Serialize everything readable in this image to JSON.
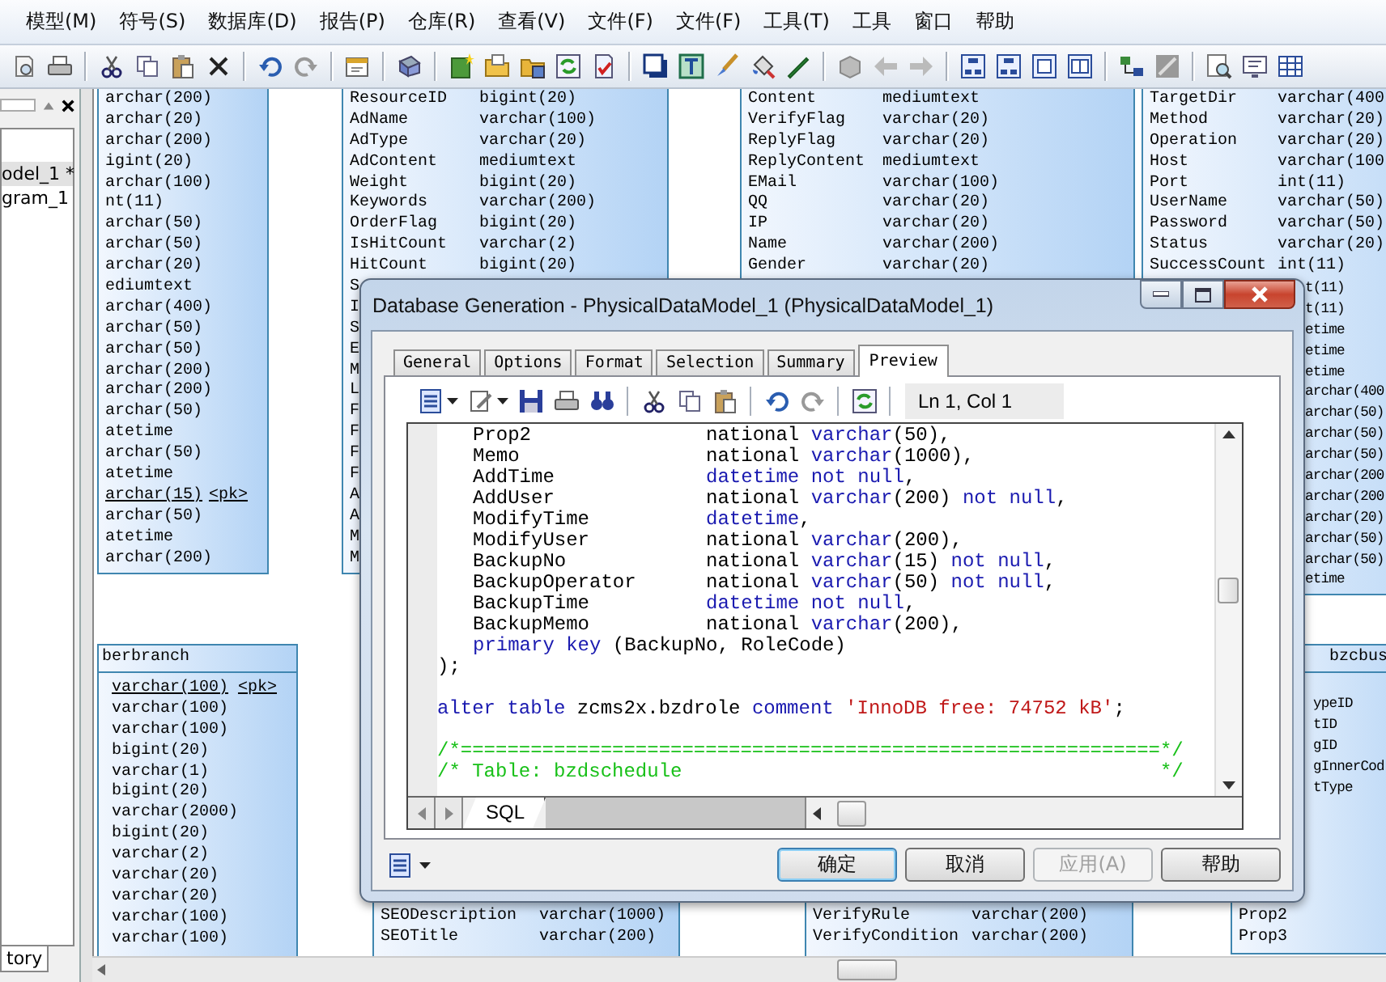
{
  "menu": [
    "模型(M)",
    "符号(S)",
    "数据库(D)",
    "报告(P)",
    "仓库(R)",
    "查看(V)",
    "文件(F)",
    "文件(F)",
    "工具(T)",
    "工具",
    "窗口",
    "帮助"
  ],
  "browser": {
    "items": [
      {
        "label": "odel_1 *",
        "selected": true
      },
      {
        "label": "gram_1",
        "selected": false
      }
    ],
    "tab": "tory"
  },
  "diagram": {
    "tables": [
      {
        "rows": [
          {
            "type": "archar(200)"
          },
          {
            "type": "archar(20)"
          },
          {
            "type": "archar(200)"
          },
          {
            "type": "igint(20)"
          },
          {
            "type": "archar(100)"
          },
          {
            "type": "nt(11)"
          },
          {
            "type": "archar(50)"
          },
          {
            "type": "archar(50)"
          },
          {
            "type": "archar(20)"
          },
          {
            "type": "ediumtext"
          },
          {
            "type": "archar(400)"
          },
          {
            "type": "archar(50)"
          },
          {
            "type": "archar(50)"
          },
          {
            "type": "archar(200)"
          },
          {
            "type": "archar(200)"
          },
          {
            "type": "archar(50)"
          },
          {
            "type": "atetime"
          },
          {
            "type": "archar(50)"
          },
          {
            "type": "atetime"
          },
          {
            "type": "archar(15)",
            "key": "<pk>"
          },
          {
            "type": "archar(50)"
          },
          {
            "type": "atetime"
          },
          {
            "type": "archar(200)"
          }
        ]
      },
      {
        "rows": [
          {
            "name": "ResourceID",
            "type": "bigint(20)"
          },
          {
            "name": "AdName",
            "type": "varchar(100)"
          },
          {
            "name": "AdType",
            "type": "varchar(20)"
          },
          {
            "name": "AdContent",
            "type": "mediumtext"
          },
          {
            "name": "Weight",
            "type": "bigint(20)"
          },
          {
            "name": "Keywords",
            "type": "varchar(200)"
          },
          {
            "name": "OrderFlag",
            "type": "bigint(20)"
          },
          {
            "name": "IsHitCount",
            "type": "varchar(2)"
          },
          {
            "name": "HitCount",
            "type": "bigint(20)"
          },
          {
            "name": "S"
          },
          {
            "name": "I"
          },
          {
            "name": "S"
          },
          {
            "name": "E"
          },
          {
            "name": "M"
          },
          {
            "name": "L"
          },
          {
            "name": "F"
          },
          {
            "name": "F"
          },
          {
            "name": "F"
          },
          {
            "name": "F"
          },
          {
            "name": "A"
          },
          {
            "name": "A"
          },
          {
            "name": "M"
          },
          {
            "name": "M"
          }
        ]
      },
      {
        "rows": [
          {
            "name": "Content",
            "type": "mediumtext"
          },
          {
            "name": "VerifyFlag",
            "type": "varchar(20)"
          },
          {
            "name": "ReplyFlag",
            "type": "varchar(20)"
          },
          {
            "name": "ReplyContent",
            "type": "mediumtext"
          },
          {
            "name": "EMail",
            "type": "varchar(100)"
          },
          {
            "name": "QQ",
            "type": "varchar(20)"
          },
          {
            "name": "IP",
            "type": "varchar(20)"
          },
          {
            "name": "Name",
            "type": "varchar(200)"
          },
          {
            "name": "Gender",
            "type": "varchar(20)"
          }
        ]
      },
      {
        "rows": [
          {
            "name": "TargetDir",
            "type": "varchar(400"
          },
          {
            "name": "Method",
            "type": "varchar(20)"
          },
          {
            "name": "Operation",
            "type": "varchar(20)"
          },
          {
            "name": "Host",
            "type": "varchar(100"
          },
          {
            "name": "Port",
            "type": "int(11)"
          },
          {
            "name": "UserName",
            "type": "varchar(50)"
          },
          {
            "name": "Password",
            "type": "varchar(50)"
          },
          {
            "name": "Status",
            "type": "varchar(20)"
          },
          {
            "name": "SuccessCount",
            "type": "int(11)"
          },
          {
            "kind": "beside",
            "type": "t(11)"
          },
          {
            "kind": "beside",
            "type": "t(11)"
          },
          {
            "kind": "beside",
            "type": "etime"
          },
          {
            "kind": "beside",
            "type": "etime"
          },
          {
            "kind": "beside",
            "type": "etime"
          },
          {
            "kind": "beside",
            "type": "archar(400"
          },
          {
            "kind": "beside",
            "type": "archar(50)"
          },
          {
            "kind": "beside",
            "type": "archar(50)"
          },
          {
            "kind": "beside",
            "type": "archar(50)"
          },
          {
            "kind": "beside",
            "type": "archar(200"
          },
          {
            "kind": "beside",
            "type": "archar(200"
          },
          {
            "kind": "beside",
            "type": "archar(20)"
          },
          {
            "kind": "beside",
            "type": "archar(50)"
          },
          {
            "kind": "beside",
            "type": "archar(50)"
          },
          {
            "kind": "beside",
            "type": "etime"
          }
        ]
      },
      {
        "header": "berbranch",
        "rows": [
          {
            "type": "varchar(100)",
            "key": "<pk>"
          },
          {
            "type": "varchar(100)"
          },
          {
            "type": "varchar(100)"
          },
          {
            "type": "bigint(20)"
          },
          {
            "type": "varchar(1)"
          },
          {
            "type": "bigint(20)"
          },
          {
            "type": "varchar(2000)"
          },
          {
            "type": "bigint(20)"
          },
          {
            "type": "varchar(2)"
          },
          {
            "type": "varchar(20)"
          },
          {
            "type": "varchar(20)"
          },
          {
            "type": "varchar(100)"
          },
          {
            "type": "varchar(100)"
          }
        ]
      },
      {
        "rows": [
          {
            "name": "SEODescription",
            "type": "varchar(1000)"
          },
          {
            "name": "SEOTitle",
            "type": "varchar(200)"
          }
        ]
      },
      {
        "rows": [
          {
            "name": "VerifyRule",
            "type": "varchar(200)"
          },
          {
            "name": "VerifyCondition",
            "type": "varchar(200)"
          }
        ]
      },
      {
        "header": "bzcbus",
        "rows": [
          {
            "kind": "beside",
            "name": "ypeID"
          },
          {
            "kind": "beside",
            "name": "tID"
          },
          {
            "kind": "beside",
            "name": "gID"
          },
          {
            "kind": "beside",
            "name": "gInnerCod"
          },
          {
            "kind": "beside",
            "name": "tType"
          },
          {
            "name": "Prop2"
          },
          {
            "name": "Prop3"
          }
        ]
      }
    ]
  },
  "dialog": {
    "title": "Database Generation - PhysicalDataModel_1 (PhysicalDataModel_1)",
    "tabs": [
      {
        "label": "General",
        "selected": false
      },
      {
        "label": "Options",
        "selected": false
      },
      {
        "label": "Format",
        "selected": false
      },
      {
        "label": "Selection",
        "selected": false
      },
      {
        "label": "Summary",
        "selected": false
      },
      {
        "label": "Preview",
        "selected": true
      }
    ],
    "position": "Ln 1, Col 1",
    "lines": [
      {
        "kind": "column",
        "column": "Prop2",
        "tokens": [
          {
            "kind": "plain",
            "text": "national "
          },
          {
            "kind": "keyword",
            "text": "varchar"
          },
          {
            "kind": "plain",
            "text": "(50),"
          }
        ]
      },
      {
        "kind": "column",
        "column": "Memo",
        "tokens": [
          {
            "kind": "plain",
            "text": "national "
          },
          {
            "kind": "keyword",
            "text": "varchar"
          },
          {
            "kind": "plain",
            "text": "(1000),"
          }
        ]
      },
      {
        "kind": "column",
        "column": "AddTime",
        "tokens": [
          {
            "kind": "keyword",
            "text": "datetime not null"
          },
          {
            "kind": "plain",
            "text": ","
          }
        ]
      },
      {
        "kind": "column",
        "column": "AddUser",
        "tokens": [
          {
            "kind": "plain",
            "text": "national "
          },
          {
            "kind": "keyword",
            "text": "varchar"
          },
          {
            "kind": "plain",
            "text": "(200) "
          },
          {
            "kind": "keyword",
            "text": "not null"
          },
          {
            "kind": "plain",
            "text": ","
          }
        ]
      },
      {
        "kind": "column",
        "column": "ModifyTime",
        "tokens": [
          {
            "kind": "keyword",
            "text": "datetime"
          },
          {
            "kind": "plain",
            "text": ","
          }
        ]
      },
      {
        "kind": "column",
        "column": "ModifyUser",
        "tokens": [
          {
            "kind": "plain",
            "text": "national "
          },
          {
            "kind": "keyword",
            "text": "varchar"
          },
          {
            "kind": "plain",
            "text": "(200),"
          }
        ]
      },
      {
        "kind": "column",
        "column": "BackupNo",
        "tokens": [
          {
            "kind": "plain",
            "text": "national "
          },
          {
            "kind": "keyword",
            "text": "varchar"
          },
          {
            "kind": "plain",
            "text": "(15) "
          },
          {
            "kind": "keyword",
            "text": "not null"
          },
          {
            "kind": "plain",
            "text": ","
          }
        ]
      },
      {
        "kind": "column",
        "column": "BackupOperator",
        "tokens": [
          {
            "kind": "plain",
            "text": "national "
          },
          {
            "kind": "keyword",
            "text": "varchar"
          },
          {
            "kind": "plain",
            "text": "(50) "
          },
          {
            "kind": "keyword",
            "text": "not null"
          },
          {
            "kind": "plain",
            "text": ","
          }
        ]
      },
      {
        "kind": "column",
        "column": "BackupTime",
        "tokens": [
          {
            "kind": "keyword",
            "text": "datetime not null"
          },
          {
            "kind": "plain",
            "text": ","
          }
        ]
      },
      {
        "kind": "column",
        "column": "BackupMemo",
        "tokens": [
          {
            "kind": "plain",
            "text": "national "
          },
          {
            "kind": "keyword",
            "text": "varchar"
          },
          {
            "kind": "plain",
            "text": "(200),"
          }
        ]
      },
      {
        "kind": "code",
        "indent": true,
        "tokens": [
          {
            "kind": "keyword",
            "text": "primary key"
          },
          {
            "kind": "plain",
            "text": " (BackupNo, RoleCode)"
          }
        ]
      },
      {
        "kind": "code",
        "indent": false,
        "tokens": [
          {
            "kind": "plain",
            "text": ");"
          }
        ]
      },
      {
        "kind": "blank"
      },
      {
        "kind": "code",
        "indent": false,
        "tokens": [
          {
            "kind": "keyword",
            "text": "alter table"
          },
          {
            "kind": "plain",
            "text": " zcms2x.bzdrole "
          },
          {
            "kind": "keyword",
            "text": "comment "
          },
          {
            "kind": "string",
            "text": "'InnoDB free: 74752 kB'"
          },
          {
            "kind": "plain",
            "text": ";"
          }
        ]
      },
      {
        "kind": "blank"
      },
      {
        "kind": "code",
        "indent": false,
        "tokens": [
          {
            "kind": "comment",
            "text": "/*============================================================*/"
          }
        ]
      },
      {
        "kind": "code",
        "indent": false,
        "tokens": [
          {
            "kind": "comment",
            "text": "/* Table: bzdschedule                                         */"
          }
        ]
      }
    ],
    "editor_tab": "SQL",
    "buttons": [
      {
        "label": "确定",
        "default": true,
        "disabled": false
      },
      {
        "label": "取消",
        "default": false,
        "disabled": false
      },
      {
        "label": "应用(A)",
        "default": false,
        "disabled": true
      },
      {
        "label": "帮助",
        "default": false,
        "disabled": false
      }
    ]
  }
}
